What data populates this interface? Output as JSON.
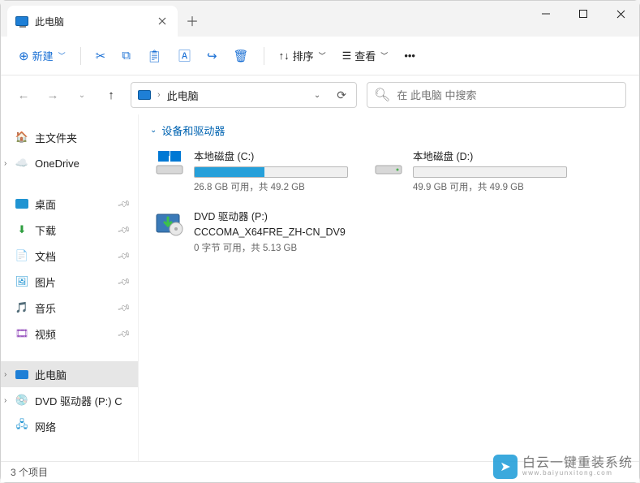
{
  "tab": {
    "title": "此电脑"
  },
  "toolbar": {
    "new_label": "新建",
    "sort_label": "排序",
    "view_label": "查看"
  },
  "nav": {
    "breadcrumb": "此电脑",
    "search_placeholder": "在 此电脑 中搜索"
  },
  "sidebar": {
    "home": "主文件夹",
    "onedrive": "OneDrive",
    "desktop": "桌面",
    "downloads": "下载",
    "documents": "文档",
    "pictures": "图片",
    "music": "音乐",
    "videos": "视频",
    "thispc": "此电脑",
    "dvd": "DVD 驱动器 (P:) C",
    "network": "网络"
  },
  "section": {
    "devices_header": "设备和驱动器"
  },
  "drives": [
    {
      "name": "本地磁盘 (C:)",
      "info": "26.8 GB 可用，共 49.2 GB",
      "fill_pct": 46,
      "type": "system"
    },
    {
      "name": "本地磁盘 (D:)",
      "info": "49.9 GB 可用，共 49.9 GB",
      "fill_pct": 0,
      "type": "local"
    },
    {
      "name": "DVD 驱动器 (P:)",
      "subname": "CCCOMA_X64FRE_ZH-CN_DV9",
      "info": "0 字节 可用，共 5.13 GB",
      "type": "dvd"
    }
  ],
  "status": {
    "count_label": "3 个项目"
  },
  "watermark": {
    "title": "白云一键重装系统",
    "url": "www.baiyunxitong.com"
  }
}
